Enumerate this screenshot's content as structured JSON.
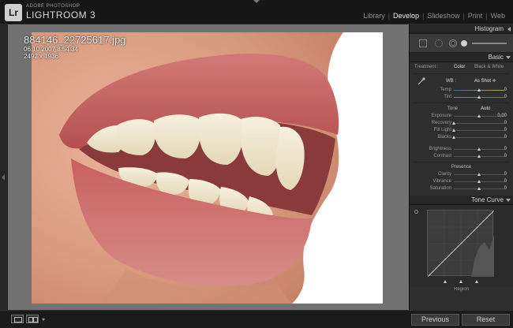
{
  "app": {
    "logo": "Lr",
    "vendor": "ADOBE PHOTOSHOP",
    "name": "LIGHTROOM 3"
  },
  "modules": [
    {
      "label": "Library",
      "active": false
    },
    {
      "label": "Develop",
      "active": true
    },
    {
      "label": "Slideshow",
      "active": false
    },
    {
      "label": "Print",
      "active": false
    },
    {
      "label": "Web",
      "active": false
    }
  ],
  "photo": {
    "filename": "884146_22725617.jpg",
    "datetime": "06.10.2007 8:54:34",
    "dimensions": "2492 x 1936"
  },
  "panel": {
    "histogram_title": "Histogram",
    "basic_title": "Basic",
    "treatment_label": "Treatment :",
    "treatment_color": "Color",
    "treatment_bw": "Black & White",
    "wb_label": "WB :",
    "wb_value": "As Shot ≑",
    "tone_title": "Tone",
    "auto_label": "Auto",
    "presence_title": "Presence",
    "tone_curve_title": "Tone Curve",
    "region_title": "Region",
    "wb_sliders": [
      {
        "label": "Temp",
        "value": "0",
        "pos": 0.5
      },
      {
        "label": "Tint",
        "value": "0",
        "pos": 0.5
      }
    ],
    "tone_sliders": [
      {
        "label": "Exposure",
        "value": "0,00",
        "pos": 0.5
      },
      {
        "label": "Recovery",
        "value": "0",
        "pos": 0.0
      },
      {
        "label": "Fill Light",
        "value": "0",
        "pos": 0.0
      },
      {
        "label": "Blacks",
        "value": "0",
        "pos": 0.0
      }
    ],
    "brightness_sliders": [
      {
        "label": "Brightness",
        "value": "0",
        "pos": 0.5
      },
      {
        "label": "Contrast",
        "value": "0",
        "pos": 0.5
      }
    ],
    "presence_sliders": [
      {
        "label": "Clarity",
        "value": "0",
        "pos": 0.5
      },
      {
        "label": "Vibrance",
        "value": "0",
        "pos": 0.5
      },
      {
        "label": "Saturation",
        "value": "0",
        "pos": 0.5
      }
    ]
  },
  "bottom": {
    "previous_label": "Previous",
    "reset_label": "Reset"
  }
}
